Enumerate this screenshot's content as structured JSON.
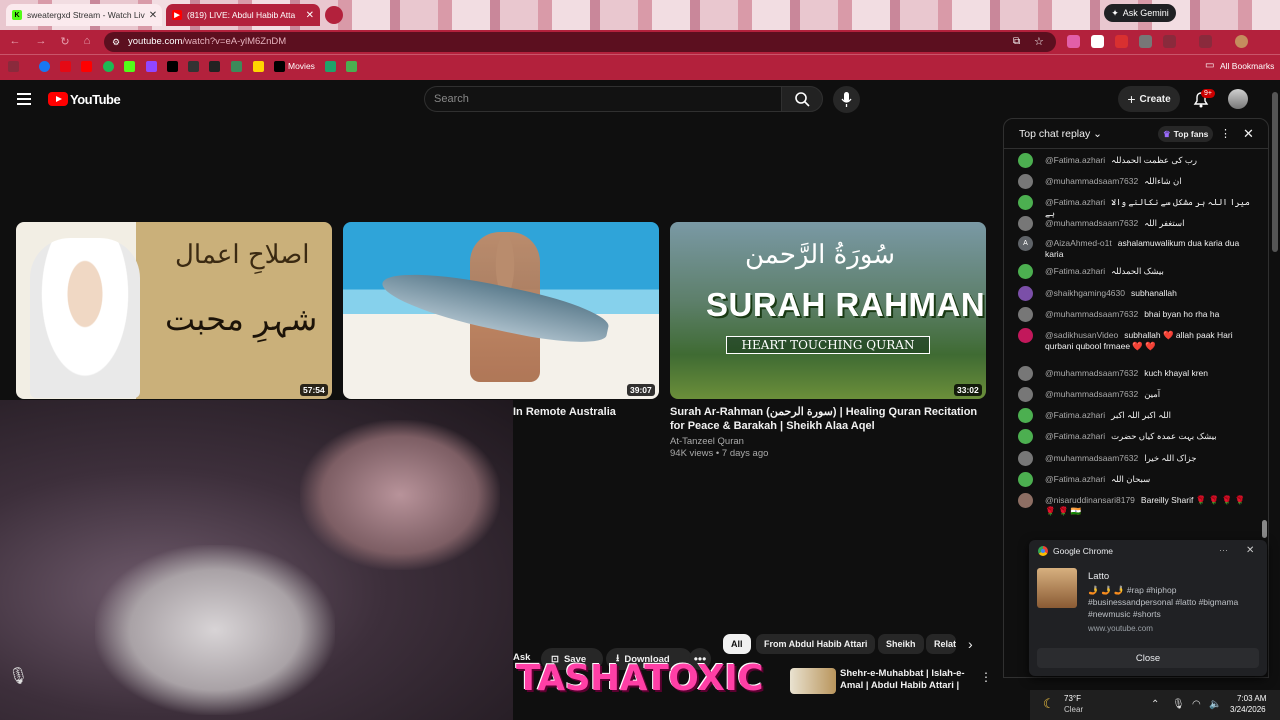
{
  "browser": {
    "tabs": [
      {
        "title": "sweatergxd Stream - Watch Liv",
        "active": false
      },
      {
        "title": "(819) LIVE: Abdul Habib Atta",
        "active": true
      }
    ],
    "ask_gemini": "Ask Gemini",
    "url": "youtube.com/watch?v=eA-ylM6ZnDM",
    "url_host": "youtube.com",
    "url_rest": "/watch?v=eA-ylM6ZnDM",
    "bookmarks_movies": "Movies",
    "all_bookmarks": "All Bookmarks"
  },
  "youtube": {
    "logo_text": "YouTube",
    "search_placeholder": "Search",
    "create_label": "Create",
    "notifications_badge": "9+"
  },
  "videos": [
    {
      "duration": "57:54",
      "thumb_text_1": "اصلاحِ اعمال",
      "thumb_text_2": "شہرِ محبت"
    },
    {
      "duration": "39:07",
      "title": "In Remote Australia"
    },
    {
      "duration": "33:02",
      "thumb_arabic": "سُورَةُ الرَّحمن",
      "thumb_title": "SURAH RAHMAN",
      "thumb_subtitle": "HEART TOUCHING QURAN",
      "title": "Surah Ar-Rahman (سورة الرحمن) | Healing Quran Recitation for Peace & Barakah | Sheikh Alaa Aqel",
      "channel": "At-Tanzeel Quran",
      "meta": "94K views • 7 days ago"
    }
  ],
  "actions": {
    "ask": "Ask",
    "save": "Save",
    "download": "Download",
    "more": "•••"
  },
  "chips": [
    "All",
    "From Abdul Habib Attari",
    "Sheikh",
    "Relat"
  ],
  "recommended": {
    "title": "Shehr-e-Muhabbat | Islah-e-Amal | Abdul Habib Attari |"
  },
  "overlay_text": "TASHATOXIC",
  "chat": {
    "title": "Top chat replay",
    "top_fans": "Top fans",
    "messages": [
      {
        "author": "@Fatima.azhari",
        "text": "رب کی عظمت الحمدللہ",
        "color": "#4caf50"
      },
      {
        "author": "@muhammadsaam7632",
        "text": "ان شاءاللہ",
        "color": "#777777"
      },
      {
        "author": "@Fatima.azhari",
        "text": "میرا اللہ ہر مشکل سے نکالنے والا ہے",
        "color": "#4caf50"
      },
      {
        "author": "@muhammadsaam7632",
        "text": "استغفر اللہ",
        "color": "#777777"
      },
      {
        "author": "@AizaAhmed-o1t",
        "text": "ashalamuwalikum dua karia dua karia",
        "color": "#5f6368",
        "initial": "A"
      },
      {
        "author": "@Fatima.azhari",
        "text": "بیشک الحمدللہ",
        "color": "#4caf50"
      },
      {
        "author": "@shaikhgaming4630",
        "text": "subhanallah",
        "color": "#7b4fa8"
      },
      {
        "author": "@muhammadsaam7632",
        "text": "bhai byan ho rha ha",
        "color": "#777777"
      },
      {
        "author": "@sadikhusanVideo",
        "text": "subhallah ❤️ allah paak Hari qurbani qubool frmaee ❤️ ❤️",
        "color": "#c2185b"
      },
      {
        "author": "@muhammadsaam7632",
        "text": "kuch khayal kren",
        "color": "#777777"
      },
      {
        "author": "@muhammadsaam7632",
        "text": "آمین",
        "color": "#777777"
      },
      {
        "author": "@Fatima.azhari",
        "text": "اللہ اکبر اللہ اکبر",
        "color": "#4caf50"
      },
      {
        "author": "@Fatima.azhari",
        "text": "بیشک بہت عمدہ کیاں حضرت",
        "color": "#4caf50"
      },
      {
        "author": "@muhammadsaam7632",
        "text": "جزاک اللہ خیرا",
        "color": "#777777"
      },
      {
        "author": "@Fatima.azhari",
        "text": "سبحان اللہ",
        "color": "#4caf50"
      },
      {
        "author": "@nisaruddinansari8179",
        "text": "Bareilly Sharif 🌹 🌹 🌹 🌹 🌹 🌹 🇮🇳",
        "color": "#8d6e63"
      }
    ]
  },
  "notification": {
    "app": "Google Chrome",
    "title": "Latto",
    "body": "🤳 🤳 🤳 #rap #hiphop #businessandpersonal #latto #bigmama #newmusic #shorts",
    "site": "www.youtube.com",
    "close_label": "Close"
  },
  "taskbar": {
    "temp": "73°F",
    "condition": "Clear",
    "time": "7:03 AM",
    "date": "3/24/2026"
  }
}
